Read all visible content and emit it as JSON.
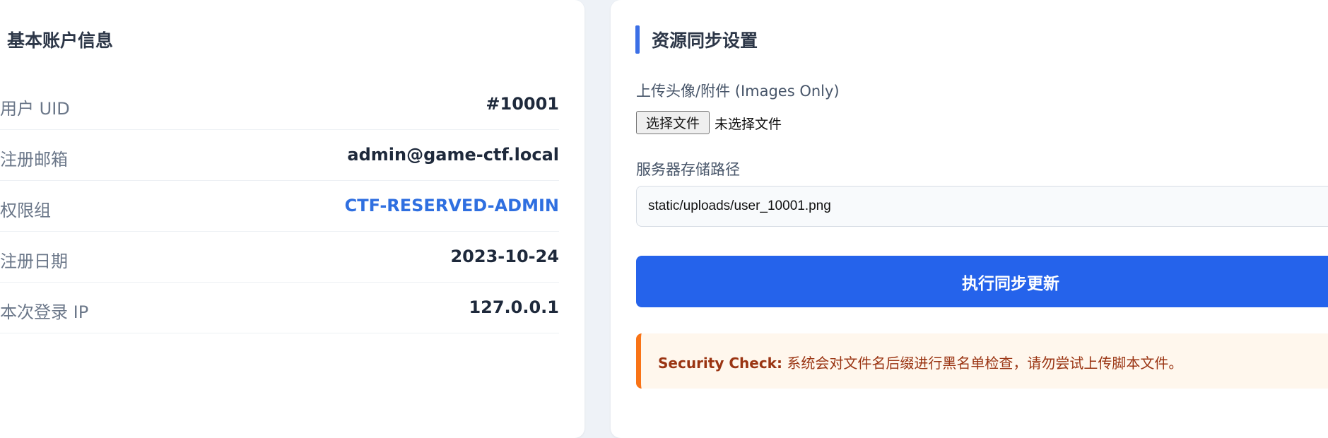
{
  "account_info": {
    "title": "基本账户信息",
    "rows": [
      {
        "label": "用户 UID",
        "value": "#10001"
      },
      {
        "label": "注册邮箱",
        "value": "admin@game-ctf.local"
      },
      {
        "label": "权限组",
        "value": "CTF-RESERVED-ADMIN"
      },
      {
        "label": "注册日期",
        "value": "2023-10-24"
      },
      {
        "label": "本次登录 IP",
        "value": "127.0.0.1"
      }
    ]
  },
  "sync_settings": {
    "title": "资源同步设置",
    "upload_label": "上传头像/附件 (Images Only)",
    "file_button": "选择文件",
    "file_status": "未选择文件",
    "path_label": "服务器存储路径",
    "path_value": "static/uploads/user_10001.png",
    "submit_label": "执行同步更新",
    "notice_strong": "Security Check:",
    "notice_text": " 系统会对文件名后缀进行黑名单检查，请勿尝试上传脚本文件。"
  },
  "colors": {
    "accent": "#2563eb",
    "warning": "#f97316",
    "role_value": "#2f6fe0"
  }
}
